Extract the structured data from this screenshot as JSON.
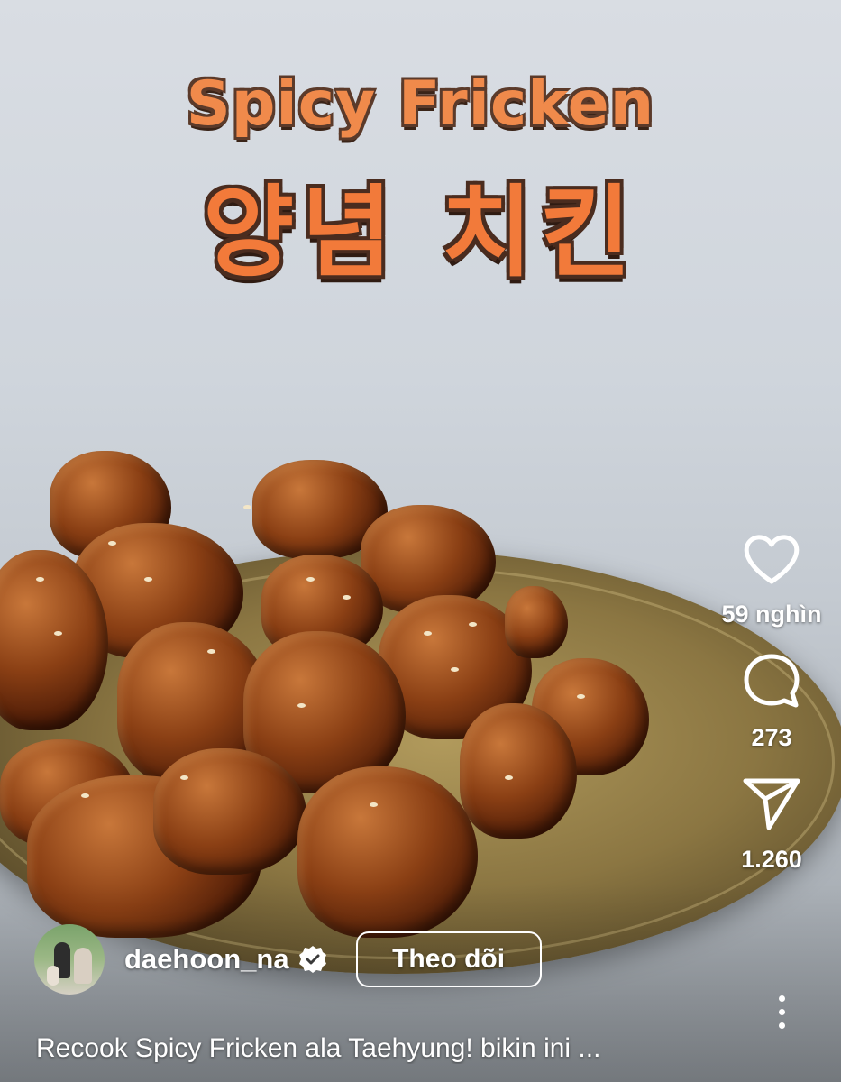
{
  "video": {
    "title_en": "Spicy Fricken",
    "title_ko": "양념 치킨"
  },
  "actions": {
    "like_count": "59 nghìn",
    "comment_count": "273",
    "share_count": "1.260"
  },
  "author": {
    "username": "daehoon_na",
    "follow_label": "Theo dõi"
  },
  "caption": "Recook Spicy Fricken ala Taehyung! bikin ini ...",
  "icons": [
    "heart-icon",
    "comment-icon",
    "send-icon",
    "verified-badge-icon",
    "more-icon"
  ],
  "colors": {
    "overlay_text": "#ffffff",
    "title_fill": "#f08a4b"
  }
}
